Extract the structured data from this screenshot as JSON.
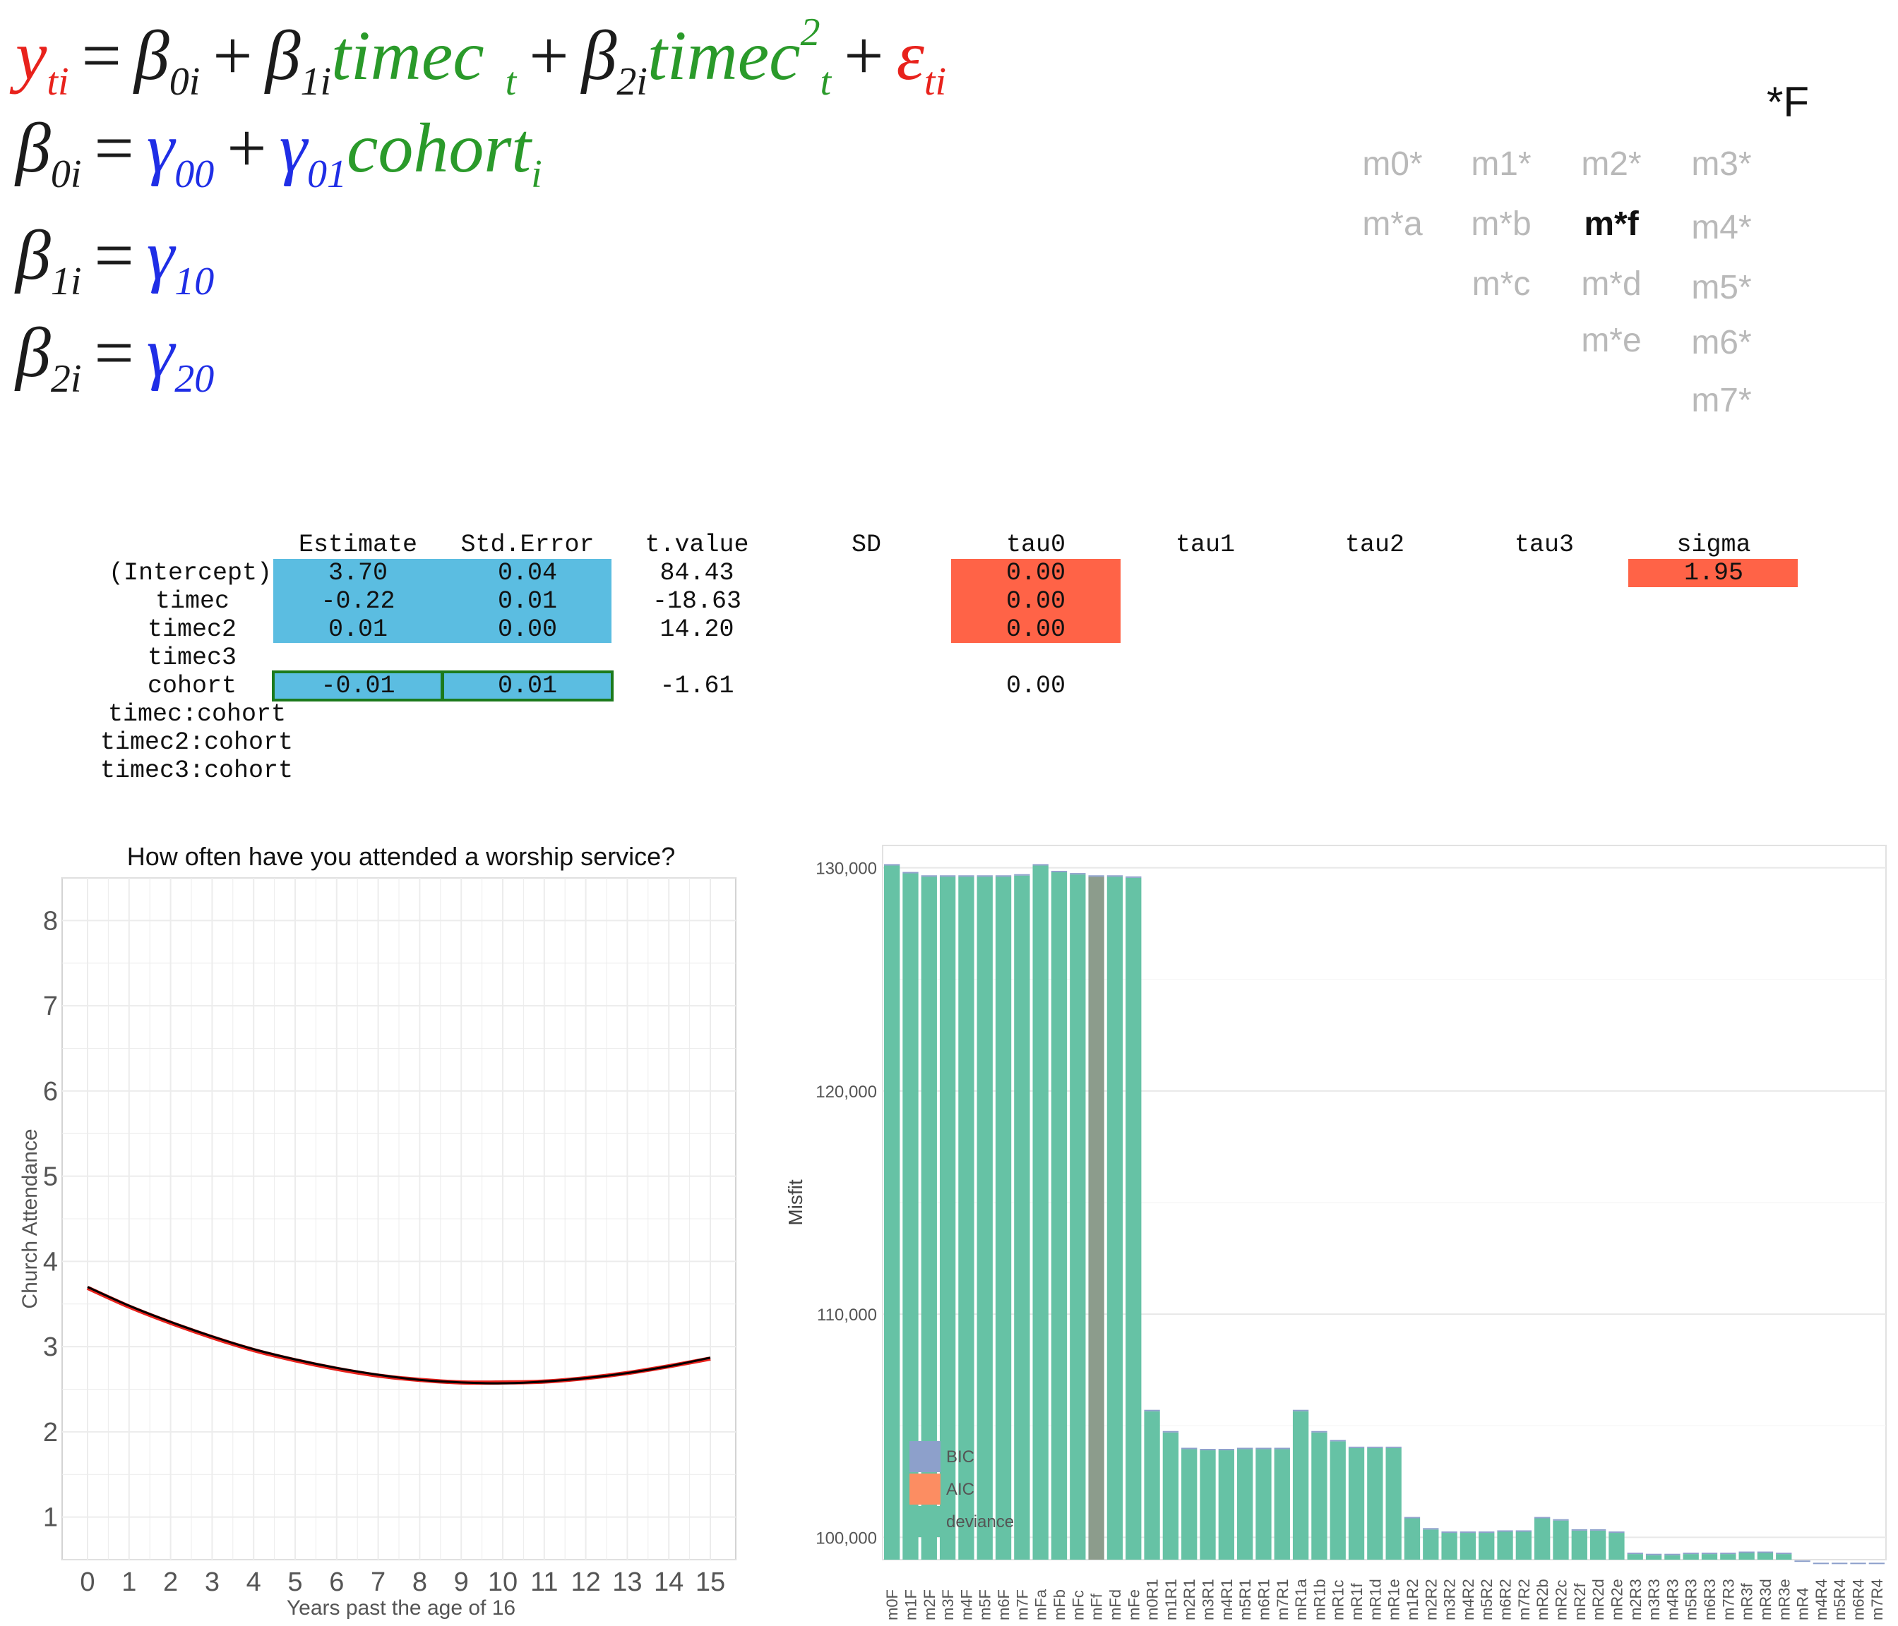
{
  "equations": {
    "level1": {
      "y": "y",
      "ti": "ti",
      "eq": "=",
      "b0": "β",
      "sub0i": "0i",
      "plus": "+",
      "b1": "β",
      "sub1i": "1i",
      "timec": "timec",
      "t": "t",
      "b2": "β",
      "sub2i": "2i",
      "timec2": "timec",
      "sup2": "2",
      "eps": "ε",
      "subti": "ti"
    },
    "level2a": {
      "b": "β",
      "sub": "0i",
      "eq": "=",
      "g00": "γ",
      "sub00": "00",
      "plus": "+",
      "g01": "γ",
      "sub01": "01",
      "cohort": "cohort",
      "subi": "i"
    },
    "level2b": {
      "b": "β",
      "sub": "1i",
      "eq": "=",
      "g": "γ",
      "gsub": "10"
    },
    "level2c": {
      "b": "β",
      "sub": "2i",
      "eq": "=",
      "g": "γ",
      "gsub": "20"
    }
  },
  "model_menu": {
    "title": "*F",
    "items": [
      {
        "label": "m0*",
        "selected": false
      },
      {
        "label": "m1*",
        "selected": false
      },
      {
        "label": "m2*",
        "selected": false
      },
      {
        "label": "m3*",
        "selected": false
      },
      {
        "label": "m*a",
        "selected": false
      },
      {
        "label": "m*b",
        "selected": false
      },
      {
        "label": "m*f",
        "selected": true
      },
      {
        "label": "m4*",
        "selected": false
      },
      {
        "label": "m*c",
        "selected": false
      },
      {
        "label": "m*d",
        "selected": false
      },
      {
        "label": "m5*",
        "selected": false
      },
      {
        "label": "m*e",
        "selected": false
      },
      {
        "label": "m6*",
        "selected": false
      },
      {
        "label": "m7*",
        "selected": false
      }
    ]
  },
  "coef_table": {
    "headers": [
      "Estimate",
      "Std.Error",
      "t.value",
      "SD",
      "tau0",
      "tau1",
      "tau2",
      "tau3",
      "sigma"
    ],
    "rows": [
      "(Intercept)",
      "timec",
      "timec2",
      "timec3",
      "cohort",
      "timec:cohort",
      "timec2:cohort",
      "timec3:cohort"
    ],
    "intercept": {
      "estimate": "3.70",
      "se": "0.04",
      "t": "84.43",
      "tau0": "0.00",
      "sigma": "1.95"
    },
    "timec": {
      "estimate": "-0.22",
      "se": "0.01",
      "t": "-18.63",
      "tau0": "0.00"
    },
    "timec2": {
      "estimate": "0.01",
      "se": "0.00",
      "t": "14.20",
      "tau0": "0.00"
    },
    "cohort": {
      "estimate": "-0.01",
      "se": "0.01",
      "t": "-1.61",
      "tau0": "0.00"
    }
  },
  "chart_data": [
    {
      "type": "line",
      "title": "How often have you attended a worship service?",
      "xlabel": "Years past the age of 16",
      "ylabel": "Church Attendance",
      "xlim": [
        0,
        15
      ],
      "ylim": [
        0.5,
        8.5
      ],
      "xticks": [
        "0",
        "1",
        "2",
        "3",
        "4",
        "5",
        "6",
        "7",
        "8",
        "9",
        "10",
        "11",
        "12",
        "13",
        "14",
        "15"
      ],
      "yticks": [
        "1",
        "2",
        "3",
        "4",
        "5",
        "6",
        "7",
        "8"
      ],
      "grid": true,
      "series": [
        {
          "color": "#e8221c",
          "x": [
            0,
            1,
            2,
            3,
            4,
            5,
            6,
            7,
            8,
            9,
            10,
            11,
            12,
            13,
            14,
            15
          ],
          "y": [
            3.69,
            3.47,
            3.28,
            3.11,
            2.96,
            2.84,
            2.74,
            2.66,
            2.61,
            2.58,
            2.58,
            2.59,
            2.63,
            2.69,
            2.77,
            2.86
          ]
        },
        {
          "color": "#000000",
          "x": [
            0,
            1,
            2,
            3,
            4,
            5,
            6,
            7,
            8,
            9,
            10,
            11,
            12,
            13,
            14,
            15
          ],
          "y": [
            3.7,
            3.48,
            3.29,
            3.12,
            2.97,
            2.85,
            2.75,
            2.67,
            2.61,
            2.58,
            2.57,
            2.59,
            2.63,
            2.69,
            2.77,
            2.87
          ]
        }
      ]
    },
    {
      "type": "bar",
      "ylabel": "Misfit",
      "ylim": [
        99000,
        131000
      ],
      "yticks": [
        "100,000",
        "110,000",
        "120,000",
        "130,000"
      ],
      "ytick_values": [
        100000,
        110000,
        120000,
        130000
      ],
      "legend": [
        "BIC",
        "AIC",
        "deviance"
      ],
      "legend_placement": "bottom-left",
      "colors": {
        "BIC": "#8da0cb",
        "AIC": "#fc8d62",
        "deviance": "#66c2a5",
        "selected": "#8c9c8c"
      },
      "selected_category": "mFf",
      "categories": [
        "m0F",
        "m1F",
        "m2F",
        "m3F",
        "m4F",
        "m5F",
        "m6F",
        "m7F",
        "mFa",
        "mFb",
        "mFc",
        "mFf",
        "mFd",
        "mFe",
        "m0R1",
        "m1R1",
        "m2R1",
        "m3R1",
        "m4R1",
        "m5R1",
        "m6R1",
        "m7R1",
        "mR1a",
        "mR1b",
        "mR1c",
        "mR1f",
        "mR1d",
        "mR1e",
        "m1R2",
        "m2R2",
        "m3R2",
        "m4R2",
        "m5R2",
        "m6R2",
        "m7R2",
        "mR2b",
        "mR2c",
        "mR2f",
        "mR2d",
        "mR2e",
        "m2R3",
        "m3R3",
        "m4R3",
        "m5R3",
        "m6R3",
        "m7R3",
        "mR3f",
        "mR3d",
        "mR3e",
        "mR4",
        "m4R4",
        "m5R4",
        "m6R4",
        "m7R4"
      ],
      "values": [
        130100,
        129750,
        129600,
        129600,
        129600,
        129600,
        129600,
        129650,
        130100,
        129800,
        129700,
        129600,
        129600,
        129550,
        105650,
        104700,
        103950,
        103900,
        103900,
        103950,
        103950,
        103950,
        105650,
        104700,
        104300,
        104000,
        104000,
        104000,
        100850,
        100350,
        100200,
        100200,
        100200,
        100250,
        100250,
        100850,
        100750,
        100300,
        100300,
        100200,
        99250,
        99200,
        99200,
        99250,
        99250,
        99250,
        99300,
        99300,
        99250,
        98900,
        98800,
        98800,
        98800,
        98800
      ]
    }
  ]
}
